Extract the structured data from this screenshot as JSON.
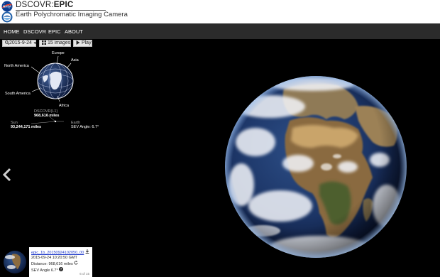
{
  "header": {
    "title_prefix": "DSCOVR:",
    "title_main": "EPIC",
    "subtitle": "Earth Polychromatic Imaging Camera"
  },
  "nav": {
    "items": [
      {
        "label": "HOME"
      },
      {
        "label": "DSCOVR"
      },
      {
        "label": "EPIC"
      },
      {
        "label": "ABOUT"
      }
    ]
  },
  "toolbar": {
    "date_label": "2015-9-24",
    "images_label": "15 images",
    "play_label": "Play"
  },
  "diagram": {
    "regions": {
      "europe": "Europe",
      "asia": "Asia",
      "north_america": "North America",
      "south_america": "South America",
      "africa": "Africa"
    },
    "satellite": {
      "name": "DSCOVR(L1)",
      "distance": "968,616 miles"
    },
    "sun": {
      "name": "Sun",
      "distance": "93,244,171 miles"
    },
    "earth": {
      "name": "Earth",
      "sev_angle": "SEV Angle: 6.7°"
    }
  },
  "info_card": {
    "image_name": "epic_1b_20150924102050_00",
    "timestamp": "2015-09-24 10:20:50 GMT",
    "distance_label": "Distance:",
    "distance_value": "968,616 miles",
    "sev_angle": "SEV Angle 6.7°",
    "counter": "6 of 15"
  },
  "icons": [
    "nasa-logo",
    "noaa-logo",
    "search-icon",
    "caret-down-icon",
    "grid-icon",
    "play-icon",
    "chevron-left-icon",
    "download-icon",
    "refresh-icon",
    "help-icon"
  ],
  "colors": {
    "navbar": "#2b2b2b",
    "background": "#000000",
    "link": "#1a35c8"
  }
}
